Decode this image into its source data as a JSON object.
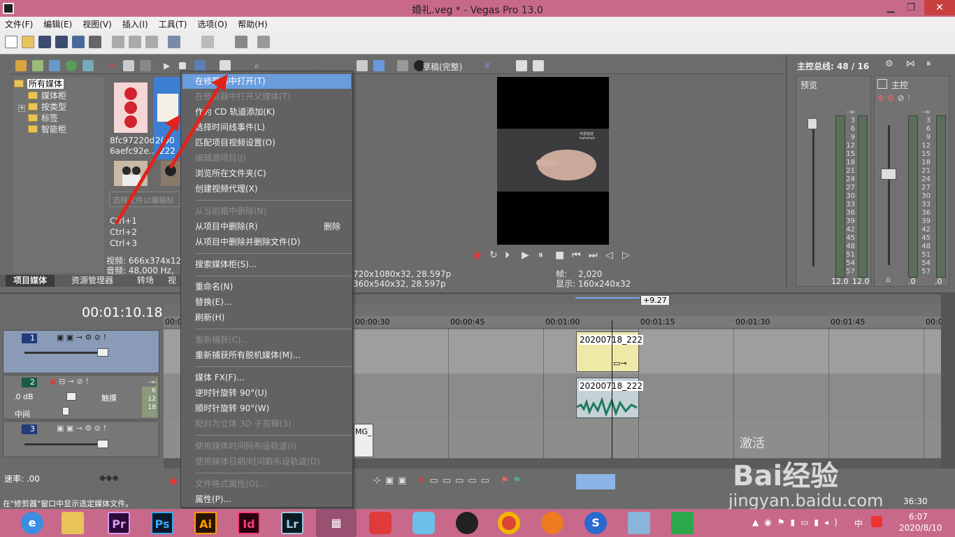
{
  "window": {
    "title": "婚礼.veg * - Vegas Pro 13.0",
    "minimize": "▁",
    "restore": "❐",
    "close": "✕"
  },
  "menubar": [
    "文件(F)",
    "编辑(E)",
    "视图(V)",
    "插入(I)",
    "工具(T)",
    "选项(O)",
    "帮助(H)"
  ],
  "media_panel": {
    "tree": [
      "所有媒体",
      "媒体柜",
      "按类型",
      "标签",
      "智能柜"
    ],
    "tree_expand": "+",
    "thumb1_caption_line1": "8fc97220d",
    "thumb1_caption_line2": "6aefc92e...",
    "thumb2_caption_line1": "2(00",
    "thumb2_caption_line2": "222",
    "search_placeholder": "选择文件以编辑标",
    "shortcuts": [
      "Ctrl+1",
      "Ctrl+2",
      "Ctrl+3"
    ],
    "info_video": "视频: 666x374x12,",
    "info_audio": "音频: 48,000 Hz,",
    "tabs": [
      "项目媒体",
      "资源管理器",
      "转场",
      "视"
    ]
  },
  "preview": {
    "quality_label": "草稿(完整)",
    "project_info": "720x1080x32, 28.597p",
    "preview_info": "360x540x32, 28.597p",
    "frame_label": "帧:",
    "frame_value": "2,020",
    "display_label": "显示:",
    "display_value": "160x240x32",
    "video_caption": "可爱娃娃 hahahah"
  },
  "master_bus": {
    "title": "主控总线: 48 / 16",
    "preview_label": "预览",
    "master_label": "主控",
    "scale": [
      "-∞",
      "3",
      "6",
      "9",
      "12",
      "15",
      "18",
      "21",
      "24",
      "27",
      "30",
      "33",
      "36",
      "39",
      "42",
      "45",
      "48",
      "51",
      "54",
      "57"
    ],
    "left_bottom": [
      "12.0",
      "12.0"
    ],
    "right_bottom": [
      ".0",
      ".0"
    ]
  },
  "context_menu": {
    "items": [
      {
        "label": "在修剪器中打开(T)",
        "state": "highlight"
      },
      {
        "label": "在修剪器中打开父媒体(T)",
        "state": "disabled"
      },
      {
        "label": "作为 CD 轨道添加(K)",
        "state": "enabled"
      },
      {
        "label": "选择时间线事件(L)",
        "state": "enabled"
      },
      {
        "label": "匹配项目视频设置(O)",
        "state": "enabled"
      },
      {
        "label": "编辑源项目(J)",
        "state": "disabled"
      },
      {
        "label": "浏览所在文件夹(C)",
        "state": "enabled"
      },
      {
        "label": "创建视频代理(X)",
        "state": "enabled"
      },
      {
        "label": "从当前箱中删除(N)",
        "state": "disabled"
      },
      {
        "label": "从项目中删除(R)",
        "state": "enabled",
        "shortcut": "删除"
      },
      {
        "label": "从项目中删除并删除文件(D)",
        "state": "enabled"
      },
      {
        "label": "搜索媒体柜(S)...",
        "state": "enabled"
      },
      {
        "label": "重命名(N)",
        "state": "enabled"
      },
      {
        "label": "替换(E)...",
        "state": "enabled"
      },
      {
        "label": "刷新(H)",
        "state": "enabled"
      },
      {
        "label": "重新捕获(C)...",
        "state": "disabled"
      },
      {
        "label": "重新捕获所有脱机媒体(M)...",
        "state": "enabled"
      },
      {
        "label": "媒体 FX(F)...",
        "state": "enabled"
      },
      {
        "label": "逆时针旋转 90°(U)",
        "state": "enabled"
      },
      {
        "label": "顺时针旋转 90°(W)",
        "state": "enabled"
      },
      {
        "label": "配对为立体 3D 子剪辑(3)",
        "state": "disabled"
      },
      {
        "label": "使用媒体时间码布设轨道(I)",
        "state": "disabled"
      },
      {
        "label": "使用媒体日期/时间戳布设轨道(D)",
        "state": "disabled"
      },
      {
        "label": "文件格式属性(O)...",
        "state": "disabled"
      },
      {
        "label": "属性(P)...",
        "state": "enabled"
      }
    ]
  },
  "timeline": {
    "timecode": "00:01:10.18",
    "marker": "+9.27",
    "ruler": [
      "00:00:00",
      "00:00:30",
      "00:00:45",
      "00:01:00",
      "00:01:15",
      "00:01:30",
      "00:01:45",
      "00:02:0"
    ],
    "tracks": [
      {
        "num": "1"
      },
      {
        "num": "2",
        "vol": ".0 dB",
        "pan": "中间",
        "mode": "触摸",
        "meter": [
          "-∞",
          "6",
          "12",
          "18"
        ]
      },
      {
        "num": "3"
      }
    ],
    "clip_video_label": "20200718_222",
    "clip_audio_label": "20200718_222",
    "clip_small_label": "MG_",
    "rate_label": "速率: .00",
    "end_time": "36:30"
  },
  "status_bar": "在\"修剪器\"窗口中显示选定媒体文件。",
  "watermark": {
    "brand": "Bai经验",
    "url": "jingyan.baidu.com",
    "activate": "激活"
  },
  "taskbar": {
    "apps": [
      "Pr",
      "Ps",
      "Ai",
      "Id",
      "Lr"
    ],
    "clock_time": "6:07",
    "clock_date": "2020/8/10",
    "ime": "中"
  },
  "colors": {
    "titlebar": "#c8698b",
    "highlight": "#6a9dde",
    "arrow": "#e0231c"
  }
}
